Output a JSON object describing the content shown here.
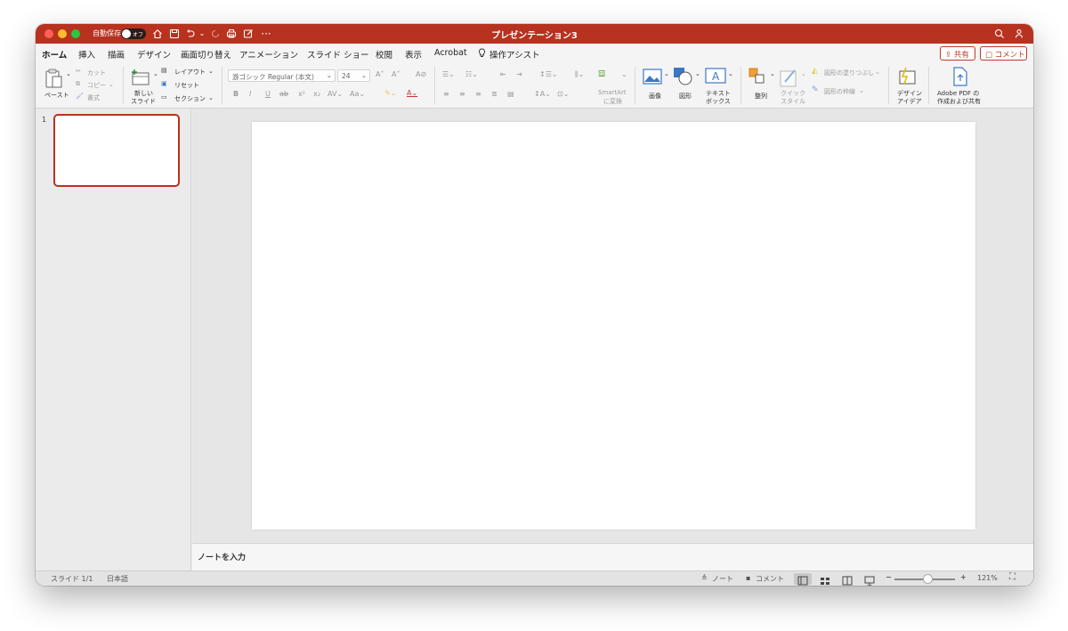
{
  "window": {
    "title": "プレゼンテーション3",
    "autosave_label": "自動保存",
    "autosave_state": "オフ"
  },
  "menu_tabs": [
    "ホーム",
    "挿入",
    "描画",
    "デザイン",
    "画面切り替え",
    "アニメーション",
    "スライド ショー",
    "校閲",
    "表示",
    "Acrobat",
    "操作アシスト"
  ],
  "active_tab": "ホーム",
  "header_buttons": {
    "share": "共有",
    "comment": "コメント"
  },
  "ribbon": {
    "paste": "ペースト",
    "cut": "カット",
    "copy": "コピー",
    "format_painter": "書式",
    "new_slide_line1": "新しい",
    "new_slide_line2": "スライド",
    "layout": "レイアウト",
    "reset": "リセット",
    "section": "セクション",
    "font_name": "游ゴシック Regular (本文)",
    "font_size": "24",
    "smartart_line1": "SmartArt",
    "smartart_line2": "に変換",
    "picture": "画像",
    "shapes": "図形",
    "textbox_line1": "テキスト",
    "textbox_line2": "ボックス",
    "arrange": "整列",
    "quick_styles_line1": "クイック",
    "quick_styles_line2": "スタイル",
    "shape_fill": "図形の塗りつぶし",
    "shape_outline": "図形の枠線",
    "design_ideas_line1": "デザイン",
    "design_ideas_line2": "アイデア",
    "adobe_line1": "Adobe PDF の",
    "adobe_line2": "作成および共有"
  },
  "thumbnails": [
    {
      "number": "1"
    }
  ],
  "notes_placeholder": "ノートを入力",
  "status": {
    "slide_info": "スライド 1/1",
    "language": "日本語",
    "notes": "ノート",
    "comments": "コメント",
    "zoom": "121%",
    "zoom_fraction": 0.55
  },
  "colors": {
    "accent": "#b7321f",
    "active_tab_underline": "#c0392b"
  }
}
